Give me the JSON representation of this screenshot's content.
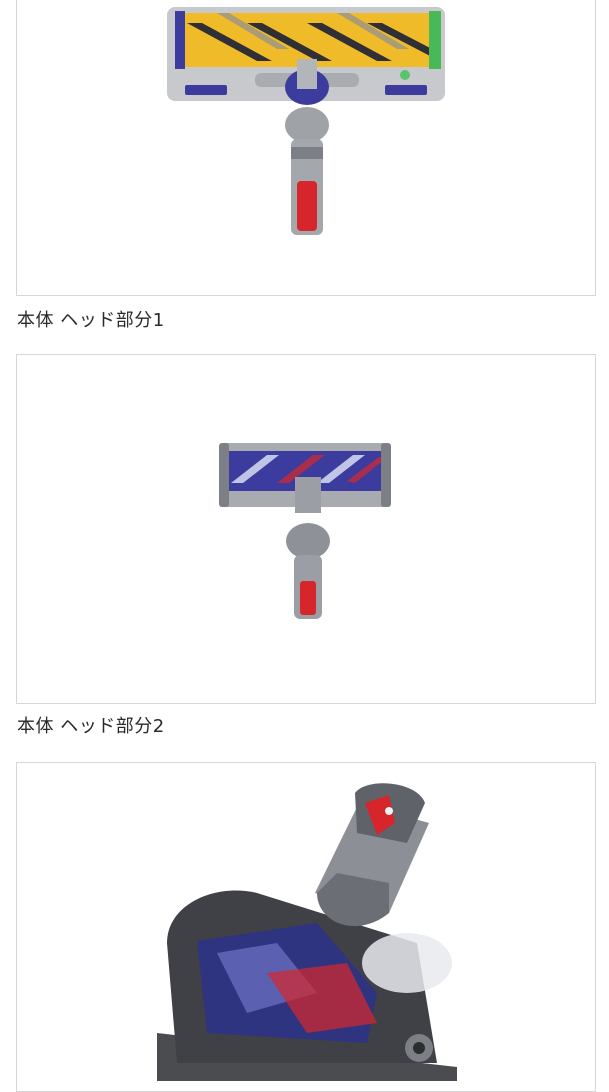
{
  "gallery": {
    "items": [
      {
        "caption": "本体 ヘッド部分1",
        "image_alt": "Dyson head with yellow/black brush roll"
      },
      {
        "caption": "本体 ヘッド部分2",
        "image_alt": "Dyson head with blue/red brush roll"
      },
      {
        "caption": "",
        "image_alt": "Dyson mini motorized tool with red accents"
      }
    ]
  },
  "colors": {
    "frame_border": "#d6d6d6",
    "caption_text": "#2a2a2a",
    "metal": "#b9bcc1",
    "nickel": "#8c9096",
    "purple": "#3c3c9e",
    "red": "#d7262b",
    "yellow": "#f2be2a",
    "dark": "#2b2d31"
  }
}
